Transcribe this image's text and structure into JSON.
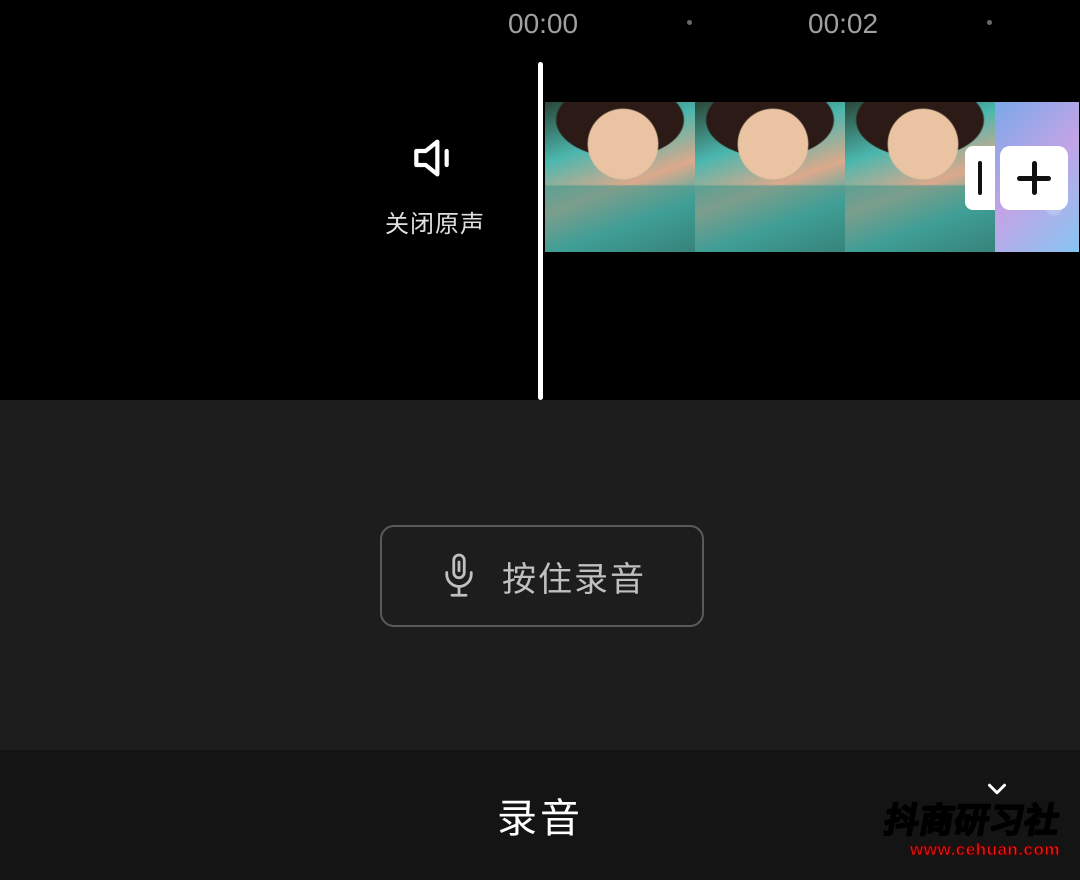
{
  "timeline": {
    "time0": "00:00",
    "time2": "00:02",
    "mute_label": "关闭原声"
  },
  "record": {
    "button_label": "按住录音"
  },
  "bottom": {
    "mode_label": "录音"
  },
  "watermark": {
    "line1": "抖商研习社",
    "line2": "www.cehuan.com"
  },
  "actions": {
    "add_clip": "add-clip",
    "clip_handle": "clip-handle"
  }
}
